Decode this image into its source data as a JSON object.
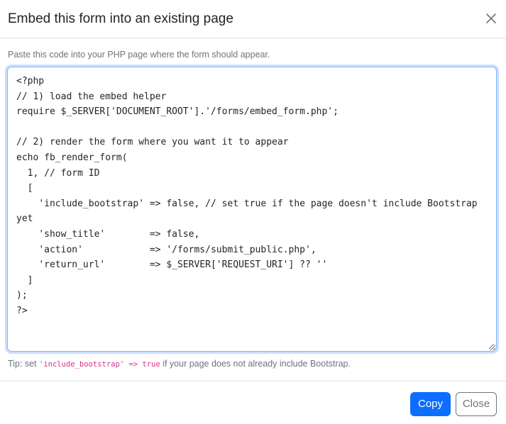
{
  "dialog": {
    "title": "Embed this form into an existing page",
    "close_icon": "close-icon"
  },
  "body": {
    "help_text": "Paste this code into your PHP page where the form should appear.",
    "code": "<?php\n// 1) load the embed helper\nrequire $_SERVER['DOCUMENT_ROOT'].'/forms/embed_form.php';\n\n// 2) render the form where you want it to appear\necho fb_render_form(\n  1, // form ID\n  [\n    'include_bootstrap' => false, // set true if the page doesn't include Bootstrap yet\n    'show_title'        => false,\n    'action'            => '/forms/submit_public.php',\n    'return_url'        => $_SERVER['REQUEST_URI'] ?? ''\n  ]\n);\n?>",
    "tip_prefix": "Tip: set",
    "tip_code": "'include_bootstrap' => true",
    "tip_suffix": "if your page does not already include Bootstrap."
  },
  "footer": {
    "copy_label": "Copy",
    "close_label": "Close"
  },
  "colors": {
    "primary": "#0d6efd",
    "secondary": "#6c757d",
    "code_pink": "#d63384",
    "focus_border": "#86b7fe"
  }
}
